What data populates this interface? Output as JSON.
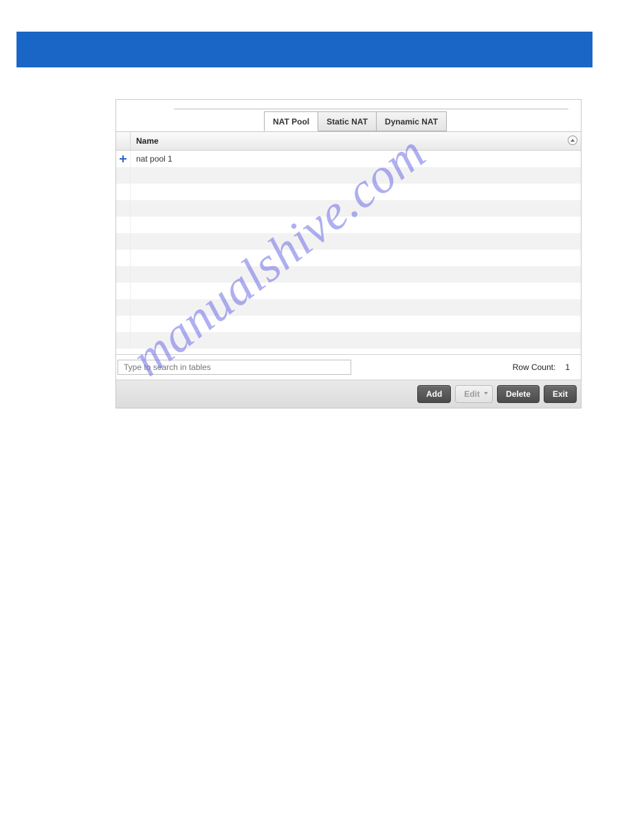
{
  "tabs": {
    "items": [
      {
        "label": "NAT Pool",
        "active": true
      },
      {
        "label": "Static NAT",
        "active": false
      },
      {
        "label": "Dynamic NAT",
        "active": false
      }
    ]
  },
  "table": {
    "header": {
      "name": "Name"
    },
    "rows": [
      {
        "name": "nat pool 1"
      }
    ],
    "blank_rows": 11
  },
  "search": {
    "placeholder": "Type to search in tables",
    "row_count_label": "Row Count:",
    "row_count_value": "1"
  },
  "buttons": {
    "add": "Add",
    "edit": "Edit",
    "delete": "Delete",
    "exit": "Exit"
  },
  "watermark": "manualshive.com"
}
